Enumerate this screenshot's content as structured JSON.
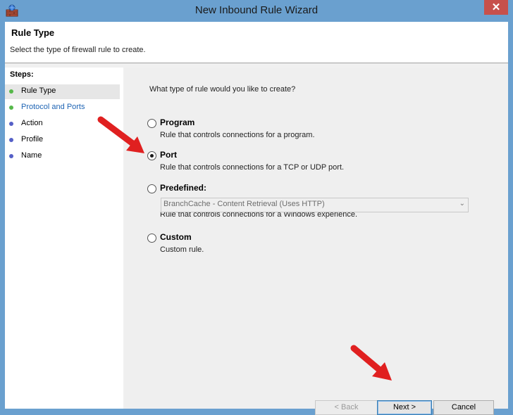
{
  "window": {
    "title": "New Inbound Rule Wizard",
    "close_label": "✕"
  },
  "header": {
    "title": "Rule Type",
    "subtitle": "Select the type of firewall rule to create."
  },
  "steps": {
    "title": "Steps:",
    "items": [
      {
        "label": "Rule Type",
        "status": "done",
        "dot_color": "#56b84a",
        "text_color": "#000000"
      },
      {
        "label": "Protocol and Ports",
        "status": "done",
        "dot_color": "#56b84a",
        "text_color": "#1e64b4"
      },
      {
        "label": "Action",
        "status": "pending",
        "dot_color": "#5560c7",
        "text_color": "#000000"
      },
      {
        "label": "Profile",
        "status": "pending",
        "dot_color": "#5560c7",
        "text_color": "#000000"
      },
      {
        "label": "Name",
        "status": "pending",
        "dot_color": "#5560c7",
        "text_color": "#000000"
      }
    ]
  },
  "main": {
    "question": "What type of rule would you like to create?",
    "options": [
      {
        "label": "Program",
        "description": "Rule that controls connections for a program.",
        "selected": false
      },
      {
        "label": "Port",
        "description": "Rule that controls connections for a TCP or UDP port.",
        "selected": true
      },
      {
        "label": "Predefined:",
        "description": "Rule that controls connections for a Windows experience.",
        "selected": false
      },
      {
        "label": "Custom",
        "description": "Custom rule.",
        "selected": false
      }
    ],
    "predefined_select": {
      "value": "BranchCache - Content Retrieval (Uses HTTP)",
      "enabled": false
    }
  },
  "buttons": {
    "back": "< Back",
    "next": "Next >",
    "cancel": "Cancel"
  },
  "colors": {
    "titlebar": "#6aa0cf",
    "close": "#c7504b",
    "annotation_arrow": "#e02020"
  }
}
